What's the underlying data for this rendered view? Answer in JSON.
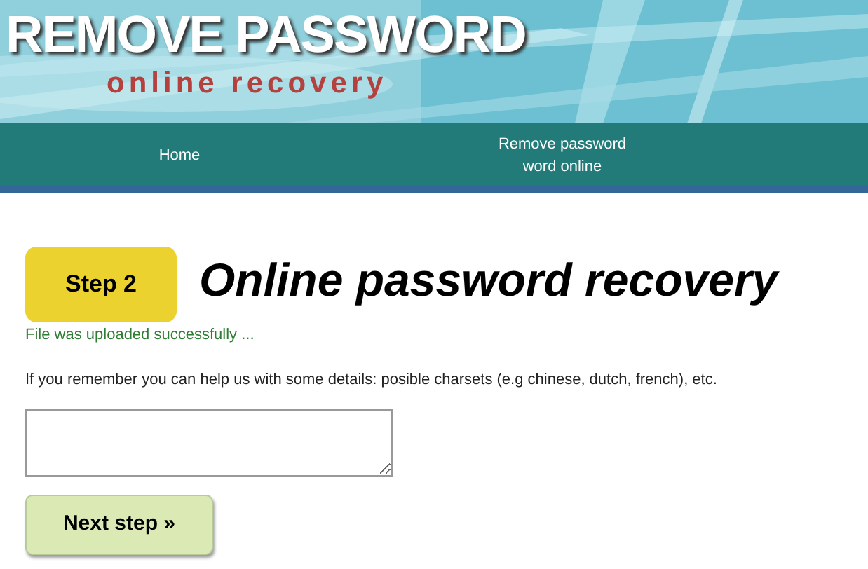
{
  "header": {
    "title": "REMOVE PASSWORD",
    "subtitle": "online recovery"
  },
  "nav": [
    {
      "label": "Home"
    },
    {
      "label": "Remove password word online"
    }
  ],
  "step_badge": "Step 2",
  "heading": "Online password recovery",
  "status_message": "File was uploaded successfully ...",
  "instructions": "If you remember you can help us with some details: posible charsets (e.g chinese, dutch, french), etc.",
  "next_button": "Next step »"
}
